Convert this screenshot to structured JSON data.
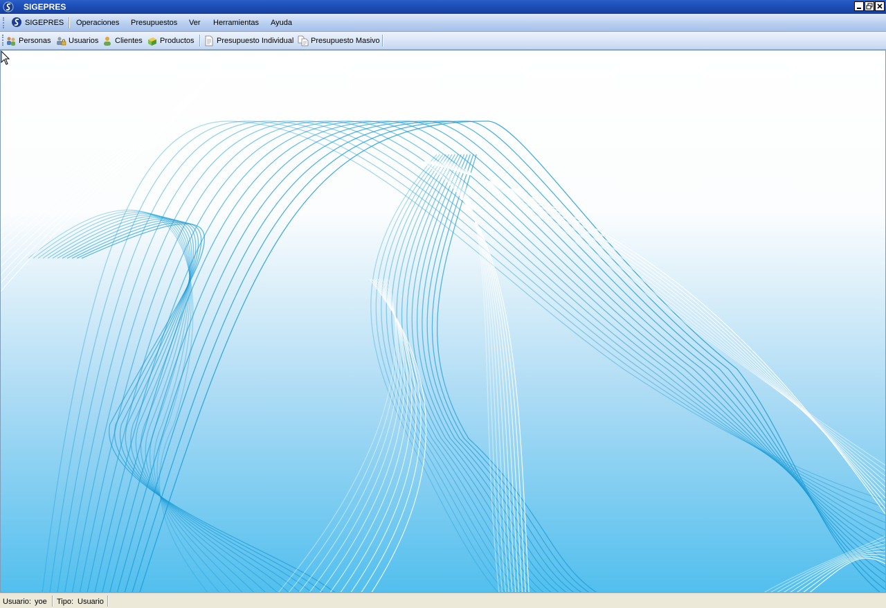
{
  "window": {
    "title": "SIGEPRES",
    "minimize_icon": "minimize-icon",
    "restore_icon": "restore-icon",
    "close_icon": "close-icon"
  },
  "menubar": {
    "items": [
      {
        "label": "SIGEPRES",
        "icon": "sigepres-logo-icon"
      },
      {
        "label": "Operaciones"
      },
      {
        "label": "Presupuestos"
      },
      {
        "label": "Ver"
      },
      {
        "label": "Herramientas"
      },
      {
        "label": "Ayuda"
      }
    ]
  },
  "toolbar": {
    "buttons": [
      {
        "label": "Personas",
        "icon": "people-icon"
      },
      {
        "label": "Usuarios",
        "icon": "users-lock-icon"
      },
      {
        "label": "Clientes",
        "icon": "client-icon"
      },
      {
        "label": "Productos",
        "icon": "products-icon"
      },
      {
        "label": "Presupuesto Individual",
        "icon": "document-icon"
      },
      {
        "label": "Presupuesto Masivo",
        "icon": "documents-icon"
      }
    ]
  },
  "statusbar": {
    "user_label": "Usuario:",
    "user_value": "yoe",
    "type_label": "Tipo:",
    "type_value": "Usuario"
  },
  "colors": {
    "title_bar": "#1e4fb8",
    "wave_line": "#1a9bd7",
    "background_bottom": "#52bfee"
  }
}
